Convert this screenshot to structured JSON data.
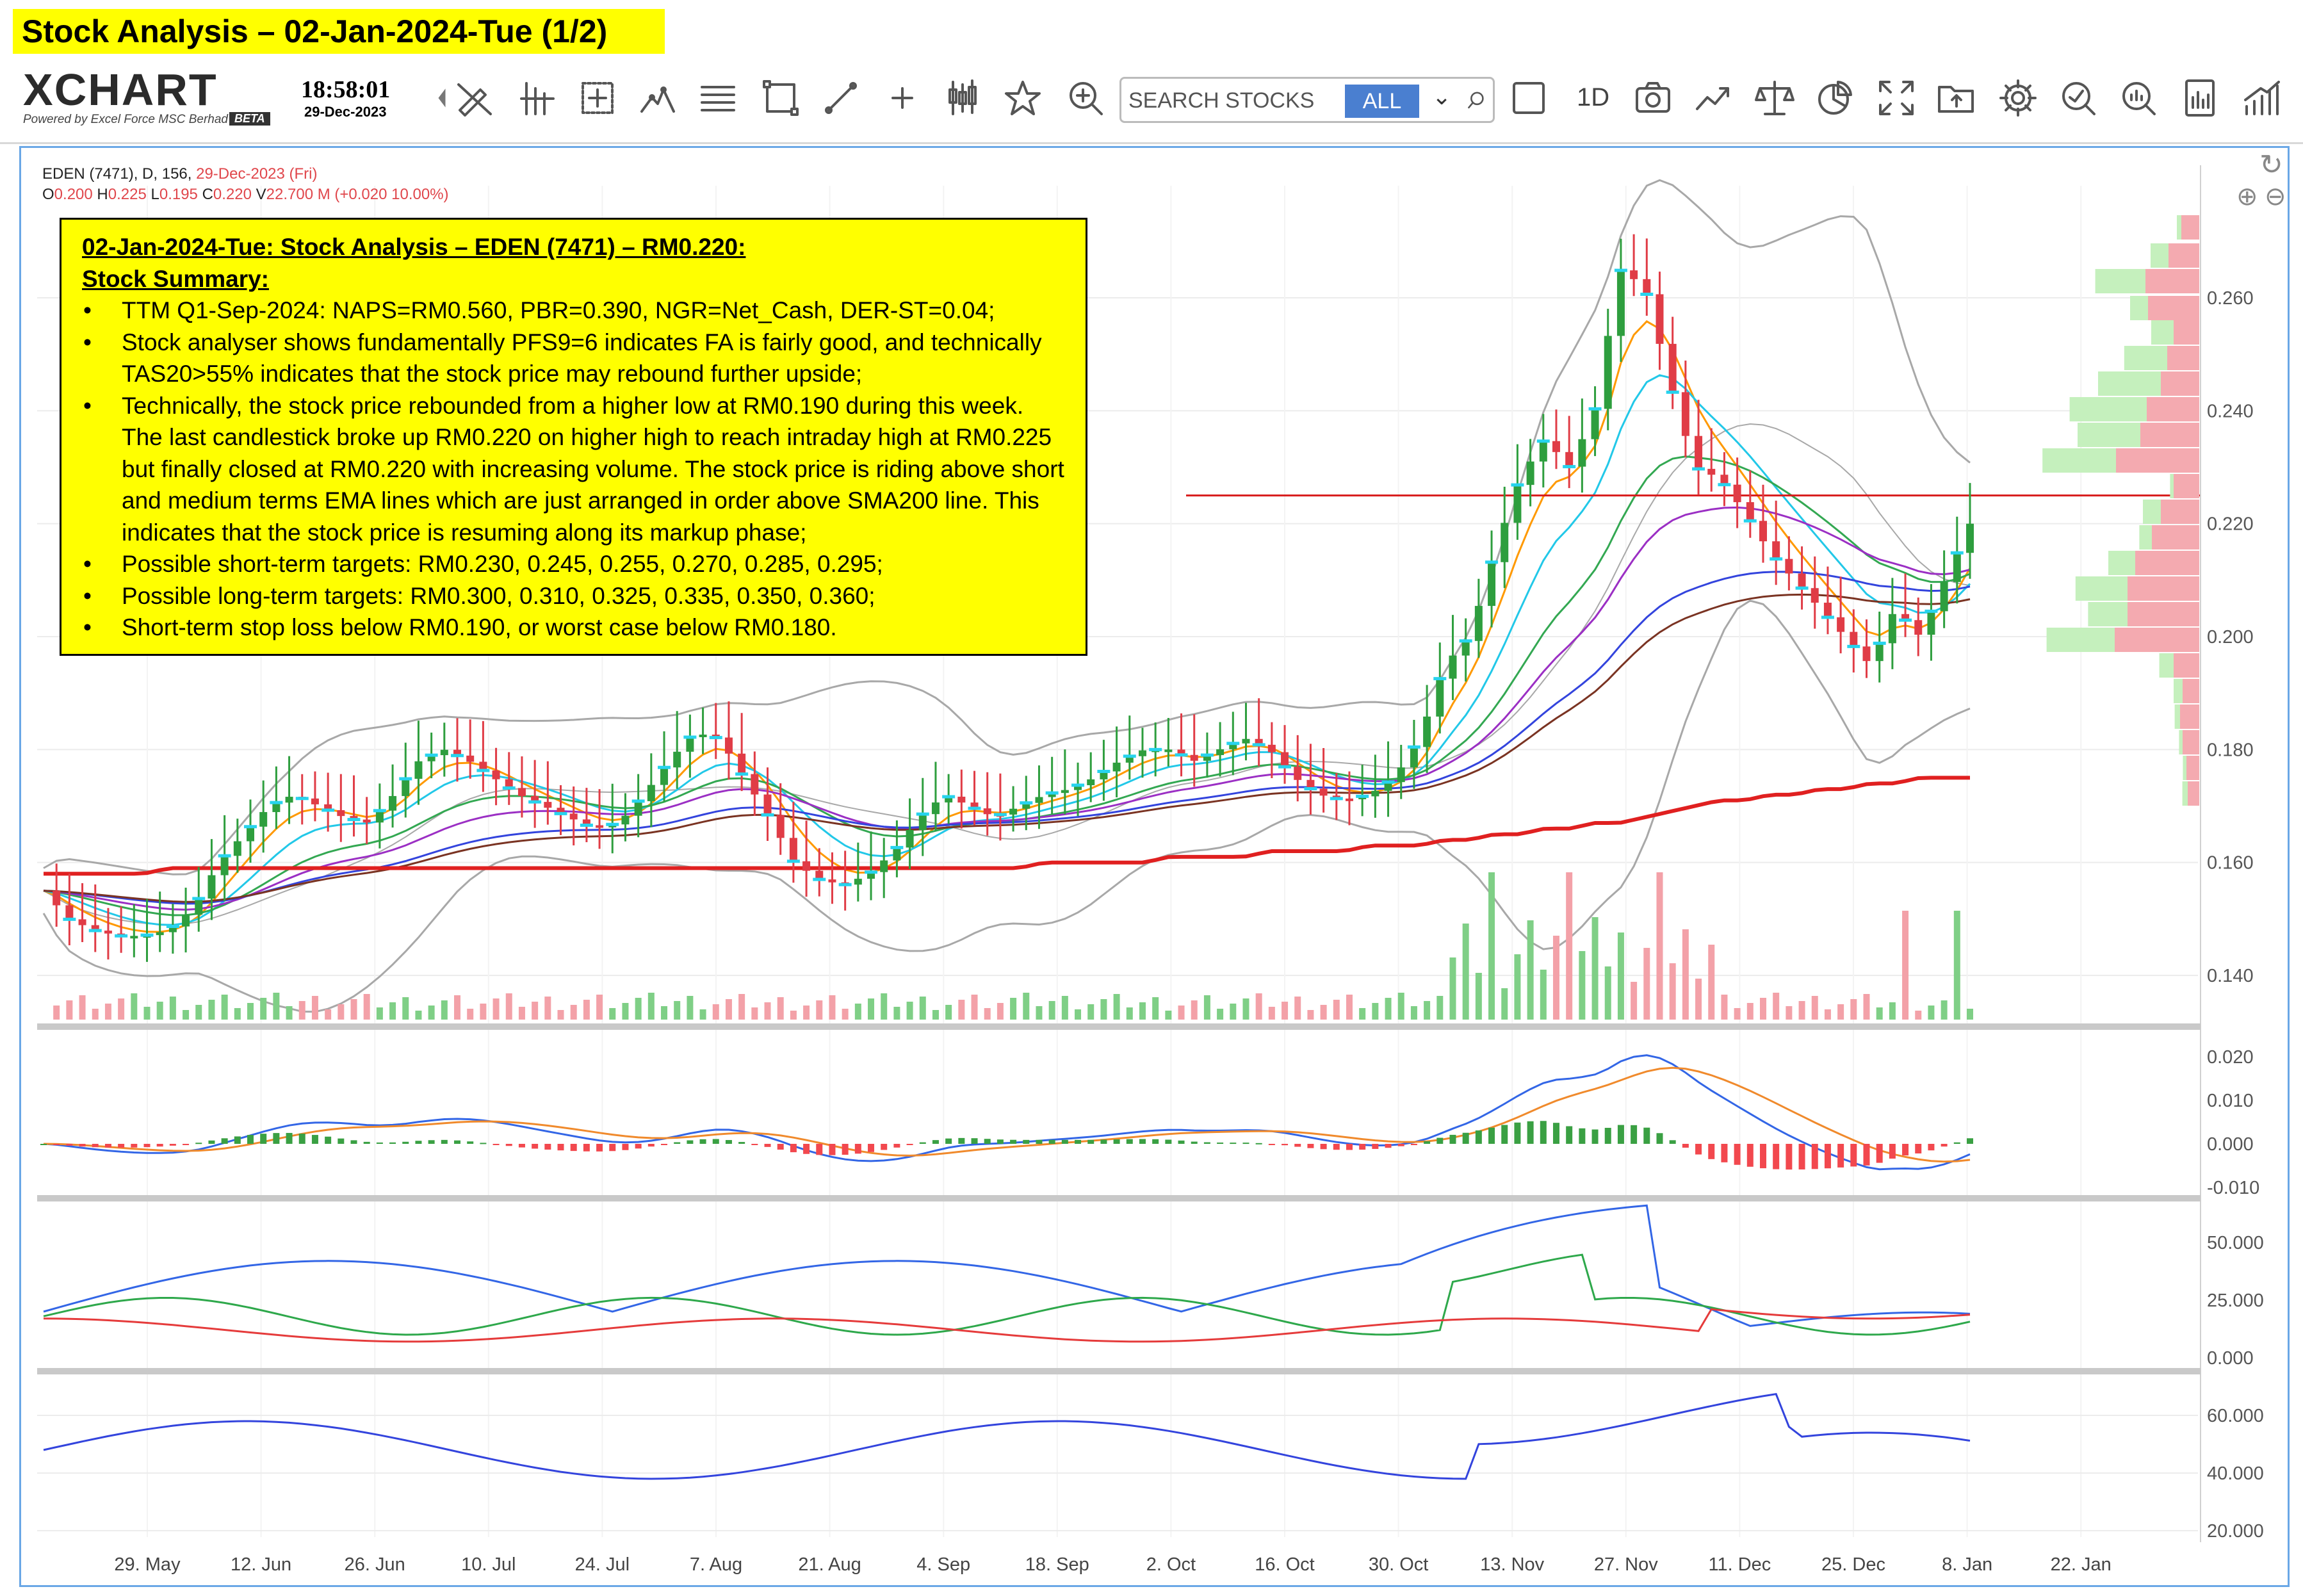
{
  "banner": {
    "title": "Stock Analysis – 02-Jan-2024-Tue (1/2)"
  },
  "toolbar": {
    "logo_word": "XCHART",
    "logo_sub": "Powered by Excel Force MSC Berhad",
    "logo_badge": "BETA",
    "time": "18:58:01",
    "date": "29-Dec-2023",
    "search_placeholder": "SEARCH STOCKS",
    "search_filter": "ALL",
    "resolution": "1D",
    "icons": [
      "collapse-arrow-icon",
      "draw-off-icon",
      "crosshair-bars-icon",
      "cursor-cross-icon",
      "fib-tool-icon",
      "lines-tool-icon",
      "rectangle-tool-icon",
      "line-tool-icon",
      "plus-icon",
      "candles-icon",
      "star-icon",
      "zoom-in-icon",
      "square-icon",
      "camera-icon",
      "trend-icon",
      "scale-icon",
      "pie-icon",
      "fullscreen-icon",
      "folder-upload-icon",
      "gear-icon",
      "analyse-icon",
      "search-zoom-icon",
      "report-icon",
      "bars-trend-icon"
    ]
  },
  "chart_header": {
    "symbol_line": "EDEN (7471), D, 156,",
    "symbol_date": "29-Dec-2023 (Fri)",
    "ohlc": [
      {
        "label": "O",
        "value": "0.200"
      },
      {
        "label": "H",
        "value": "0.225"
      },
      {
        "label": "L",
        "value": "0.195"
      },
      {
        "label": "C",
        "value": "0.220"
      },
      {
        "label": "V",
        "value": "22.700 M (+0.020 10.00%)"
      }
    ]
  },
  "summary": {
    "title": "02-Jan-2024-Tue: Stock Analysis – EDEN (7471) – RM0.220:",
    "subtitle": "Stock Summary:",
    "bullets": [
      "TTM Q1-Sep-2024: NAPS=RM0.560, PBR=0.390, NGR=Net_Cash, DER-ST=0.04;",
      "Stock analyser shows fundamentally PFS9=6 indicates FA is fairly good, and technically TAS20>55% indicates that the stock price may rebound further upside;",
      "Technically, the stock price rebounded from a higher low at RM0.190 during this week. The last candlestick broke up RM0.220 on higher high to reach intraday high at RM0.225 but finally closed at RM0.220 with increasing volume.  The stock price is riding above short and medium terms EMA lines which are just arranged in order above SMA200 line.  This indicates that the stock price is resuming along its markup phase;",
      "Possible short-term targets: RM0.230, 0.245, 0.255, 0.270, 0.285, 0.295;",
      "Possible long-term targets: RM0.300, 0.310, 0.325, 0.335, 0.350, 0.360;",
      "Short-term stop loss below RM0.190, or worst case below RM0.180."
    ]
  },
  "chart_data": {
    "type": "line",
    "title": "EDEN (7471), D, 156",
    "price_axis": {
      "ticks": [
        "0.260",
        "0.240",
        "0.220",
        "0.200",
        "0.180",
        "0.160",
        "0.140"
      ],
      "ylim": [
        0.135,
        0.275
      ]
    },
    "macd_axis": {
      "ticks": [
        "0.020",
        "0.010",
        "0.000",
        "-0.010"
      ]
    },
    "dmi_axis": {
      "ticks": [
        "50.000",
        "25.000",
        "0.000"
      ]
    },
    "rsi_axis": {
      "ticks": [
        "60.000",
        "40.000",
        "20.000"
      ]
    },
    "x_ticks": [
      "29. May",
      "12. Jun",
      "26. Jun",
      "10. Jul",
      "24. Jul",
      "7. Aug",
      "21. Aug",
      "4. Sep",
      "18. Sep",
      "2. Oct",
      "16. Oct",
      "30. Oct",
      "13. Nov",
      "27. Nov",
      "11. Dec",
      "25. Dec",
      "8. Jan",
      "22. Jan"
    ],
    "resistance_line": 0.225,
    "series": [
      {
        "name": "close",
        "values": [
          0.155,
          0.15,
          0.148,
          0.147,
          0.147,
          0.148,
          0.152,
          0.16,
          0.165,
          0.17,
          0.172,
          0.17,
          0.168,
          0.167,
          0.172,
          0.178,
          0.18,
          0.178,
          0.175,
          0.172,
          0.17,
          0.168,
          0.166,
          0.167,
          0.172,
          0.178,
          0.183,
          0.182,
          0.175,
          0.168,
          0.16,
          0.157,
          0.156,
          0.158,
          0.162,
          0.168,
          0.172,
          0.17,
          0.168,
          0.17,
          0.172,
          0.173,
          0.175,
          0.178,
          0.18,
          0.18,
          0.178,
          0.18,
          0.182,
          0.18,
          0.175,
          0.172,
          0.171,
          0.172,
          0.175,
          0.182,
          0.195,
          0.2,
          0.215,
          0.228,
          0.235,
          0.23,
          0.24,
          0.265,
          0.262,
          0.245,
          0.23,
          0.228,
          0.222,
          0.215,
          0.21,
          0.205,
          0.2,
          0.195,
          0.205,
          0.2,
          0.21,
          0.22
        ]
      },
      {
        "name": "sma200",
        "values": [
          0.158,
          0.158,
          0.158,
          0.158,
          0.158,
          0.159,
          0.159,
          0.159,
          0.159,
          0.159,
          0.159,
          0.159,
          0.159,
          0.159,
          0.159,
          0.159,
          0.159,
          0.159,
          0.159,
          0.159,
          0.159,
          0.159,
          0.159,
          0.159,
          0.159,
          0.159,
          0.159,
          0.159,
          0.159,
          0.159,
          0.159,
          0.159,
          0.159,
          0.159,
          0.159,
          0.159,
          0.159,
          0.159,
          0.159,
          0.159,
          0.16,
          0.16,
          0.16,
          0.16,
          0.16,
          0.161,
          0.161,
          0.161,
          0.161,
          0.162,
          0.162,
          0.162,
          0.162,
          0.163,
          0.163,
          0.163,
          0.164,
          0.164,
          0.165,
          0.165,
          0.166,
          0.166,
          0.167,
          0.167,
          0.168,
          0.169,
          0.17,
          0.171,
          0.171,
          0.172,
          0.172,
          0.173,
          0.173,
          0.174,
          0.174,
          0.175,
          0.175,
          0.175
        ]
      }
    ],
    "volume_profile": true
  }
}
